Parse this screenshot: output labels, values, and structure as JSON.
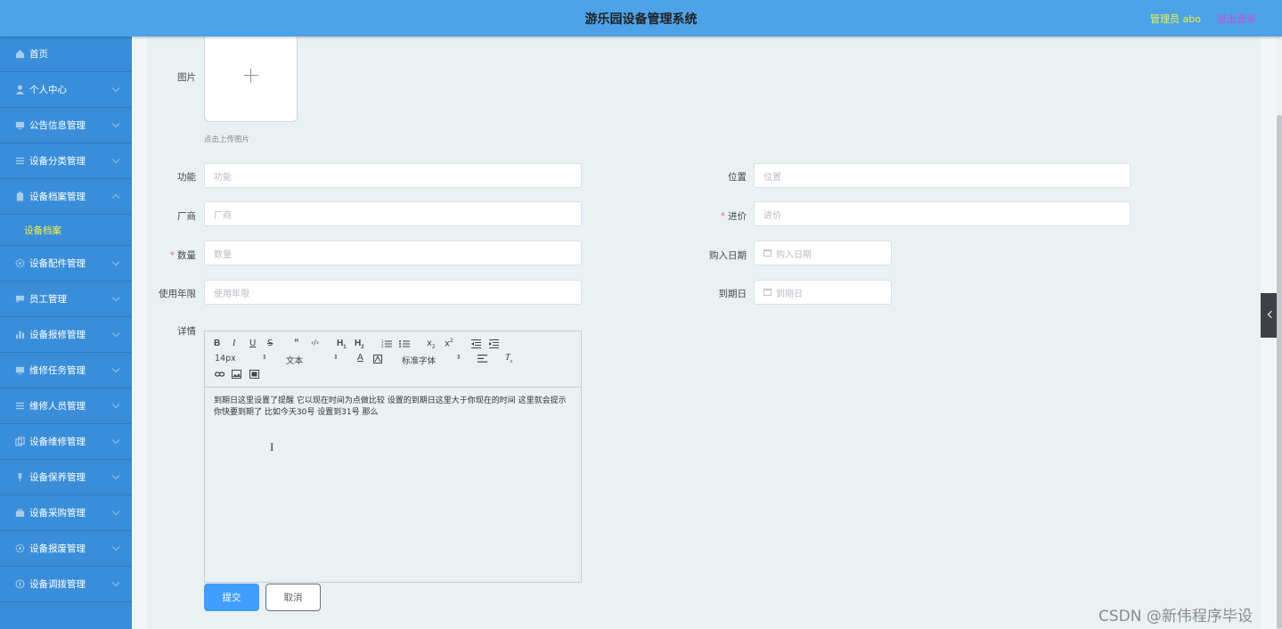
{
  "header": {
    "title": "游乐园设备管理系统",
    "user": "管理员 abo",
    "logout": "退出登录"
  },
  "sidebar": {
    "items": [
      {
        "label": "首页",
        "icon": "home-icon"
      },
      {
        "label": "个人中心",
        "icon": "user-icon"
      },
      {
        "label": "公告信息管理",
        "icon": "monitor-icon"
      },
      {
        "label": "设备分类管理",
        "icon": "list-icon"
      },
      {
        "label": "设备档案管理",
        "icon": "clipboard-icon"
      },
      {
        "label": "设备配件管理",
        "icon": "gear-icon"
      },
      {
        "label": "员工管理",
        "icon": "chat-icon"
      },
      {
        "label": "设备报修管理",
        "icon": "chart-icon"
      },
      {
        "label": "维修任务管理",
        "icon": "monitor-icon"
      },
      {
        "label": "维修人员管理",
        "icon": "list-icon"
      },
      {
        "label": "设备维修管理",
        "icon": "copy-icon"
      },
      {
        "label": "设备保养管理",
        "icon": "microphone-icon"
      },
      {
        "label": "设备采购管理",
        "icon": "briefcase-icon"
      },
      {
        "label": "设备报废管理",
        "icon": "gear-icon"
      },
      {
        "label": "设备调拨管理",
        "icon": "compass-icon"
      }
    ],
    "active_sub": "设备档案"
  },
  "form": {
    "image_label": "图片",
    "upload_tip": "点击上传图片",
    "function_label": "功能",
    "function_placeholder": "功能",
    "location_label": "位置",
    "location_placeholder": "位置",
    "vendor_label": "厂商",
    "vendor_placeholder": "厂商",
    "price_label": "进价",
    "price_placeholder": "进价",
    "quantity_label": "数量",
    "quantity_placeholder": "数量",
    "purchase_date_label": "购入日期",
    "purchase_date_placeholder": "购入日期",
    "service_life_label": "使用年限",
    "service_life_placeholder": "使用年限",
    "expiry_label": "到期日",
    "expiry_placeholder": "到期日",
    "detail_label": "详情",
    "detail_content": "到期日这里设置了提醒 它以现在时间为点做比较 设置的到期日这里大于你现在的时间 这里就会提示你快要到期了 比如今天30号 设置到31号 那么",
    "submit": "提交",
    "cancel": "取消"
  },
  "editor": {
    "font_size": "14px",
    "text_style": "文本",
    "font_family": "标准字体"
  },
  "watermark": "CSDN @新伟程序毕设"
}
